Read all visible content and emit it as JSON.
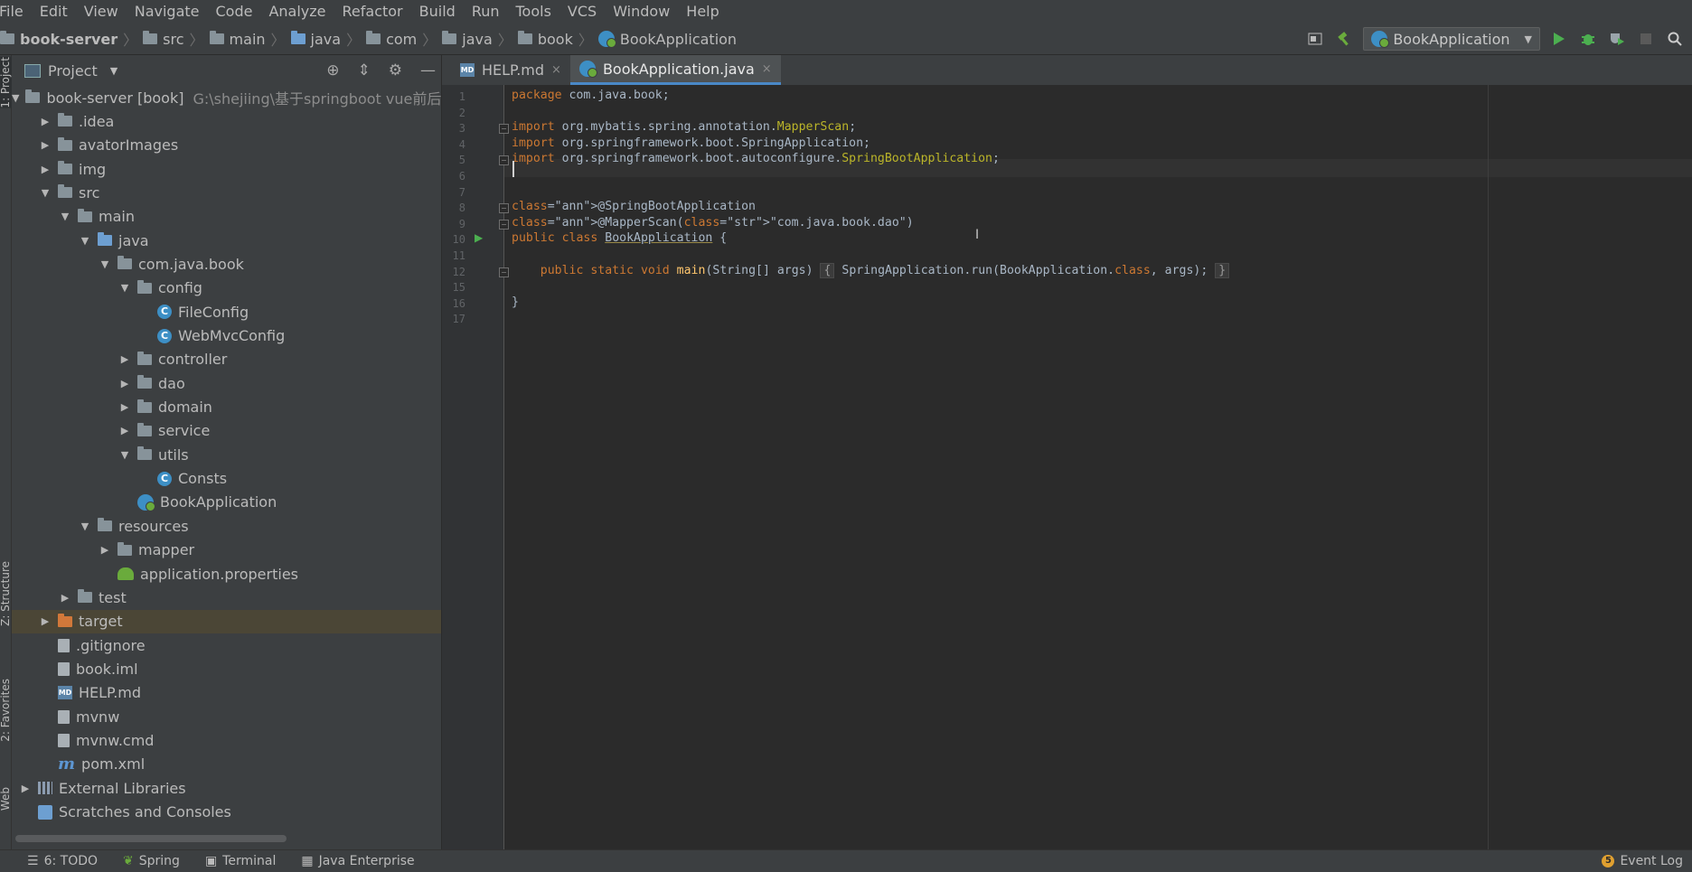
{
  "menu": [
    "File",
    "Edit",
    "View",
    "Navigate",
    "Code",
    "Analyze",
    "Refactor",
    "Build",
    "Run",
    "Tools",
    "VCS",
    "Window",
    "Help"
  ],
  "breadcrumb": [
    "book-server",
    "src",
    "main",
    "java",
    "com",
    "java",
    "book",
    "BookApplication"
  ],
  "toolbar": {
    "run_config": "BookApplication"
  },
  "left_strip": {
    "project": "1: Project",
    "structure": "Z: Structure",
    "favorites": "2: Favorites",
    "web": "Web"
  },
  "project_panel": {
    "title": "Project",
    "tree": [
      {
        "label": "book-server [book]",
        "path": "G:\\shejiing\\基于springboot vue前后端分",
        "depth": 0,
        "arrow": "open",
        "icon": "module",
        "bold_part": "[book]"
      },
      {
        "label": ".idea",
        "depth": 1,
        "arrow": "closed",
        "icon": "folder"
      },
      {
        "label": "avatorImages",
        "depth": 1,
        "arrow": "closed",
        "icon": "folder"
      },
      {
        "label": "img",
        "depth": 1,
        "arrow": "closed",
        "icon": "folder"
      },
      {
        "label": "src",
        "depth": 1,
        "arrow": "open",
        "icon": "folder"
      },
      {
        "label": "main",
        "depth": 2,
        "arrow": "open",
        "icon": "folder"
      },
      {
        "label": "java",
        "depth": 3,
        "arrow": "open",
        "icon": "folder-blue"
      },
      {
        "label": "com.java.book",
        "depth": 4,
        "arrow": "open",
        "icon": "package"
      },
      {
        "label": "config",
        "depth": 5,
        "arrow": "open",
        "icon": "package"
      },
      {
        "label": "FileConfig",
        "depth": 6,
        "arrow": "none",
        "icon": "class"
      },
      {
        "label": "WebMvcConfig",
        "depth": 6,
        "arrow": "none",
        "icon": "class"
      },
      {
        "label": "controller",
        "depth": 5,
        "arrow": "closed",
        "icon": "package"
      },
      {
        "label": "dao",
        "depth": 5,
        "arrow": "closed",
        "icon": "package"
      },
      {
        "label": "domain",
        "depth": 5,
        "arrow": "closed",
        "icon": "package"
      },
      {
        "label": "service",
        "depth": 5,
        "arrow": "closed",
        "icon": "package"
      },
      {
        "label": "utils",
        "depth": 5,
        "arrow": "open",
        "icon": "package"
      },
      {
        "label": "Consts",
        "depth": 6,
        "arrow": "none",
        "icon": "class"
      },
      {
        "label": "BookApplication",
        "depth": 5,
        "arrow": "none",
        "icon": "spring-class"
      },
      {
        "label": "resources",
        "depth": 3,
        "arrow": "open",
        "icon": "folder-res"
      },
      {
        "label": "mapper",
        "depth": 4,
        "arrow": "closed",
        "icon": "folder"
      },
      {
        "label": "application.properties",
        "depth": 4,
        "arrow": "none",
        "icon": "props"
      },
      {
        "label": "test",
        "depth": 2,
        "arrow": "closed",
        "icon": "folder"
      },
      {
        "label": "target",
        "depth": 1,
        "arrow": "closed",
        "icon": "folder-orange",
        "selected": true
      },
      {
        "label": ".gitignore",
        "depth": 1,
        "arrow": "none",
        "icon": "file"
      },
      {
        "label": "book.iml",
        "depth": 1,
        "arrow": "none",
        "icon": "file"
      },
      {
        "label": "HELP.md",
        "depth": 1,
        "arrow": "none",
        "icon": "md"
      },
      {
        "label": "mvnw",
        "depth": 1,
        "arrow": "none",
        "icon": "file"
      },
      {
        "label": "mvnw.cmd",
        "depth": 1,
        "arrow": "none",
        "icon": "file"
      },
      {
        "label": "pom.xml",
        "depth": 1,
        "arrow": "none",
        "icon": "maven"
      },
      {
        "label": "External Libraries",
        "depth": 0,
        "arrow": "closed",
        "icon": "lib"
      },
      {
        "label": "Scratches and Consoles",
        "depth": 0,
        "arrow": "none",
        "icon": "scratch"
      }
    ]
  },
  "tabs": [
    {
      "label": "HELP.md",
      "active": false
    },
    {
      "label": "BookApplication.java",
      "active": true
    }
  ],
  "editor": {
    "line_numbers": [
      "1",
      "2",
      "3",
      "4",
      "5",
      "6",
      "7",
      "8",
      "9",
      "10",
      "11",
      "12",
      "15",
      "16",
      "17"
    ],
    "lines": [
      "package com.java.book;",
      "",
      "import org.mybatis.spring.annotation.MapperScan;",
      "import org.springframework.boot.SpringApplication;",
      "import org.springframework.boot.autoconfigure.SpringBootApplication;",
      "",
      "",
      "@SpringBootApplication",
      "@MapperScan(\"com.java.book.dao\")",
      "public class BookApplication {",
      "",
      "    public static void main(String[] args) { SpringApplication.run(BookApplication.class, args); }",
      "",
      "}",
      ""
    ]
  },
  "bottom_bar": {
    "todo": "6: TODO",
    "spring": "Spring",
    "terminal": "Terminal",
    "java_enterprise": "Java Enterprise",
    "event_count": "5",
    "event_log": "Event Log"
  }
}
